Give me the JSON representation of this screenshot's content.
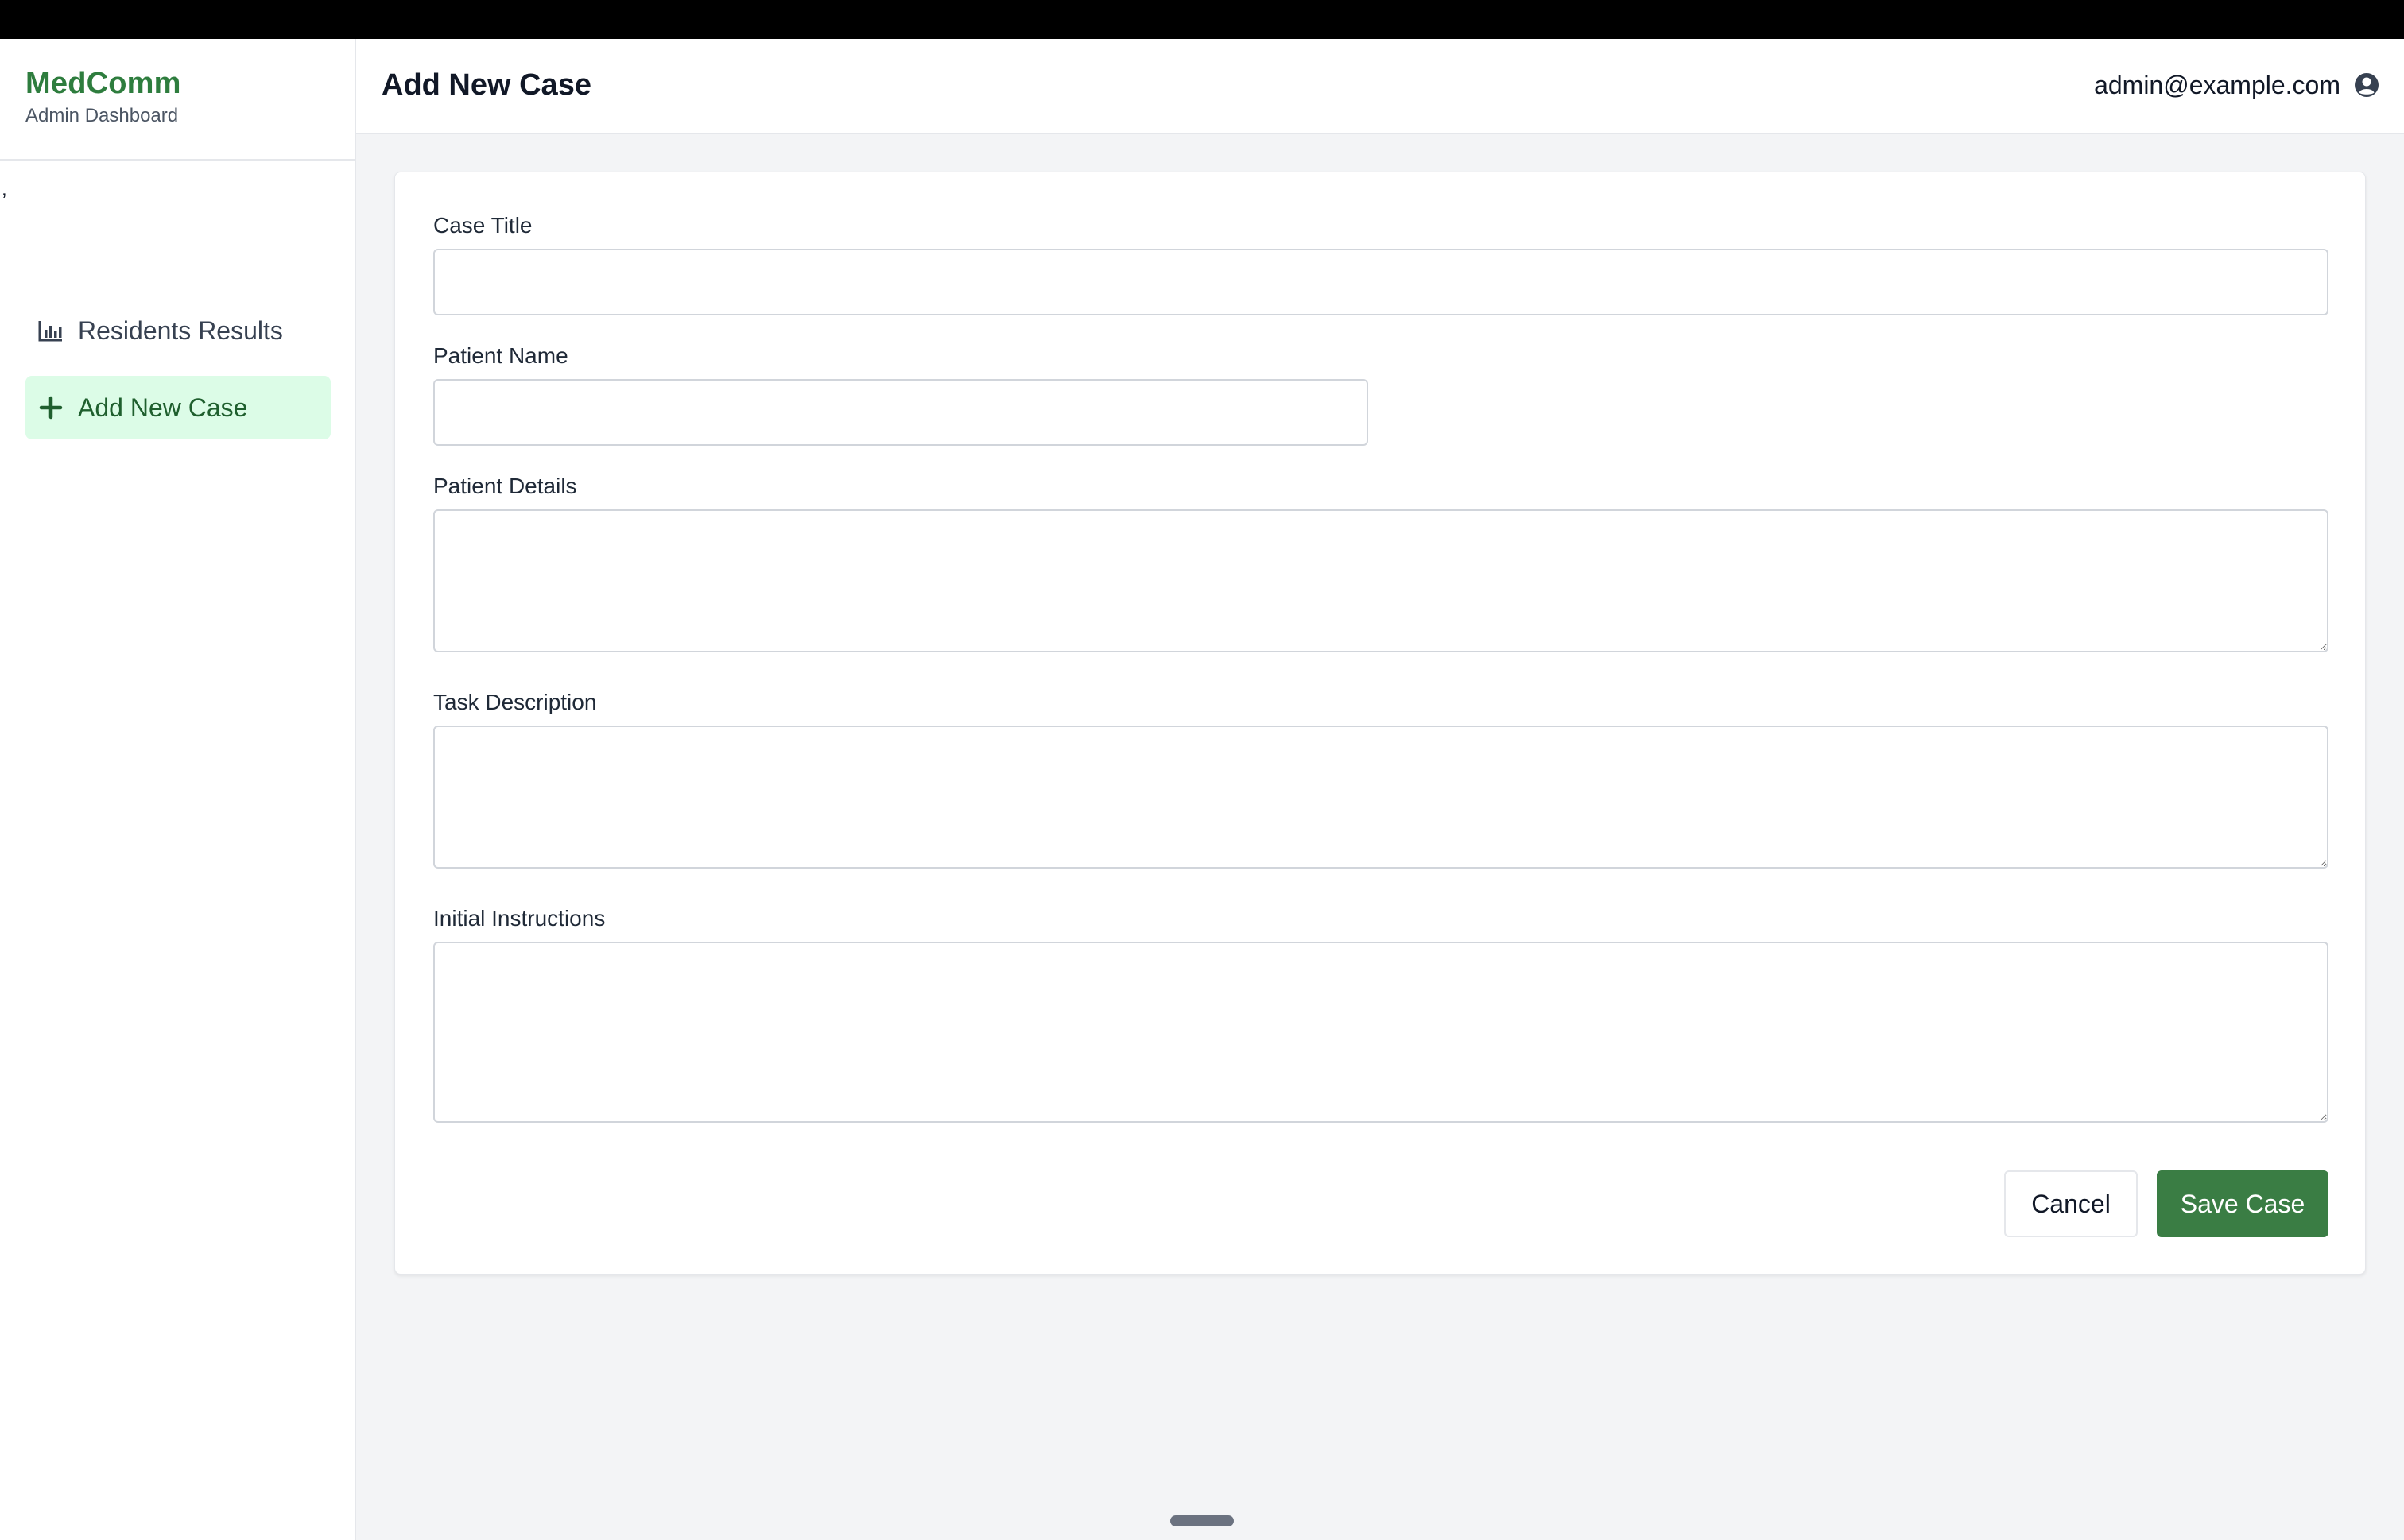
{
  "brand": {
    "name": "MedComm",
    "subtitle": "Admin Dashboard"
  },
  "stray_mark": ",",
  "sidebar": {
    "items": [
      {
        "label": "Residents Results",
        "icon": "bar-chart-icon",
        "active": false
      },
      {
        "label": "Add New Case",
        "icon": "plus-icon",
        "active": true
      }
    ]
  },
  "header": {
    "title": "Add New Case",
    "user_email": "admin@example.com"
  },
  "form": {
    "case_title": {
      "label": "Case Title",
      "value": ""
    },
    "patient_name": {
      "label": "Patient Name",
      "value": ""
    },
    "patient_details": {
      "label": "Patient Details",
      "value": ""
    },
    "task_description": {
      "label": "Task Description",
      "value": ""
    },
    "initial_instructions": {
      "label": "Initial Instructions",
      "value": ""
    },
    "cancel_label": "Cancel",
    "save_label": "Save Case"
  },
  "colors": {
    "brand": "#2e7d3e",
    "primary_button": "#3a7d44",
    "active_nav_bg": "#dcfce7",
    "page_bg": "#f3f4f6"
  }
}
